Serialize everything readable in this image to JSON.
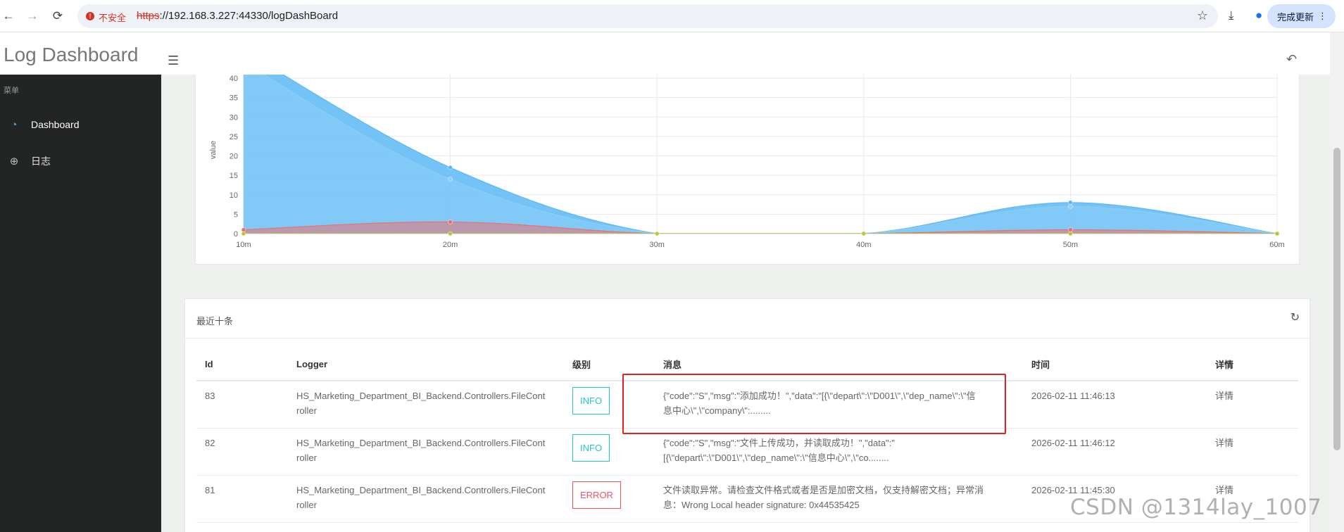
{
  "browser": {
    "security_label": "不安全",
    "url_scheme": "https",
    "url_rest": "://192.168.3.227:44330/logDashBoard",
    "update_button": "完成更新"
  },
  "app": {
    "title": "Log Dashboard"
  },
  "sidebar": {
    "section_title": "菜单",
    "items": [
      {
        "label": "Dashboard",
        "icon": "gauge-icon",
        "active": true
      },
      {
        "label": "日志",
        "icon": "crosshair-icon",
        "active": false
      }
    ]
  },
  "chart_data": {
    "type": "area",
    "x": [
      "10m",
      "20m",
      "30m",
      "40m",
      "50m",
      "60m"
    ],
    "ylabel": "value",
    "yticks": [
      0,
      5,
      10,
      15,
      20,
      25,
      30,
      35,
      40
    ],
    "ylim": [
      0,
      40
    ],
    "grid": true,
    "series": [
      {
        "values": [
          47,
          17,
          0,
          0,
          8,
          0
        ],
        "color": "#5bb8f5"
      },
      {
        "values": [
          44,
          14,
          0,
          0,
          7,
          0
        ],
        "color": "#8dcdf7"
      },
      {
        "values": [
          1,
          3,
          0,
          0,
          1,
          0
        ],
        "color": "#ec6f6f"
      },
      {
        "values": [
          0,
          0,
          0,
          0,
          0,
          0
        ],
        "color": "#b8c734"
      }
    ]
  },
  "table": {
    "title": "最近十条",
    "columns": [
      "Id",
      "Logger",
      "级别",
      "消息",
      "时间",
      "详情"
    ],
    "rows": [
      {
        "id": "83",
        "logger_1": "HS_Marketing_Department_BI_Backend.Controllers.FileCont",
        "logger_2": "roller",
        "level": "INFO",
        "message_1": "{\"code\":\"S\",\"msg\":\"添加成功！\",\"data\":\"[{\\\"depart\\\":\\\"D001\\\",\\\"dep_name\\\":\\\"信",
        "message_2": "息中心\\\",\\\"company\\\":........",
        "time": "2026-02-11 11:46:13",
        "detail": "详情"
      },
      {
        "id": "82",
        "logger_1": "HS_Marketing_Department_BI_Backend.Controllers.FileCont",
        "logger_2": "roller",
        "level": "INFO",
        "message_1": "{\"code\":\"S\",\"msg\":\"文件上传成功，并读取成功！\",\"data\":\"",
        "message_2": "[{\\\"depart\\\":\\\"D001\\\",\\\"dep_name\\\":\\\"信息中心\\\",\\\"co........",
        "time": "2026-02-11 11:46:12",
        "detail": "详情"
      },
      {
        "id": "81",
        "logger_1": "HS_Marketing_Department_BI_Backend.Controllers.FileCont",
        "logger_2": "roller",
        "level": "ERROR",
        "message_1": "文件读取异常。请检查文件格式或者是否是加密文档，仅支持解密文档；异常消",
        "message_2": "息：Wrong Local header signature: 0x44535425",
        "time": "2026-02-11 11:45:30",
        "detail": "详情"
      }
    ]
  },
  "watermark": "CSDN @1314lay_1007"
}
